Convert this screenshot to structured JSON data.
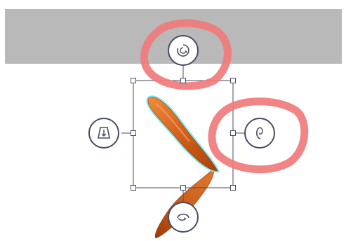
{
  "canvas": {
    "background_color": "#ffffff",
    "band_color": "#b9b9b9",
    "selection_color": "#4a4a66",
    "shape_fill": "#d2691e",
    "shape_glow": "#7fe7f0",
    "annotation_color": "#f07a7a"
  },
  "selection": {
    "handles": [
      "top-left",
      "top-center",
      "top-right",
      "middle-left",
      "middle-right",
      "bottom-left",
      "bottom-center",
      "bottom-right"
    ]
  },
  "controls": [
    {
      "id": "rotate-3d-top",
      "icon": "rotate-clockwise-icon"
    },
    {
      "id": "rotate-3d-right",
      "icon": "rotate-vertical-icon"
    },
    {
      "id": "rotate-3d-bottom",
      "icon": "rotate-horizontal-icon"
    },
    {
      "id": "perspective-left",
      "icon": "perspective-tilt-icon"
    }
  ]
}
